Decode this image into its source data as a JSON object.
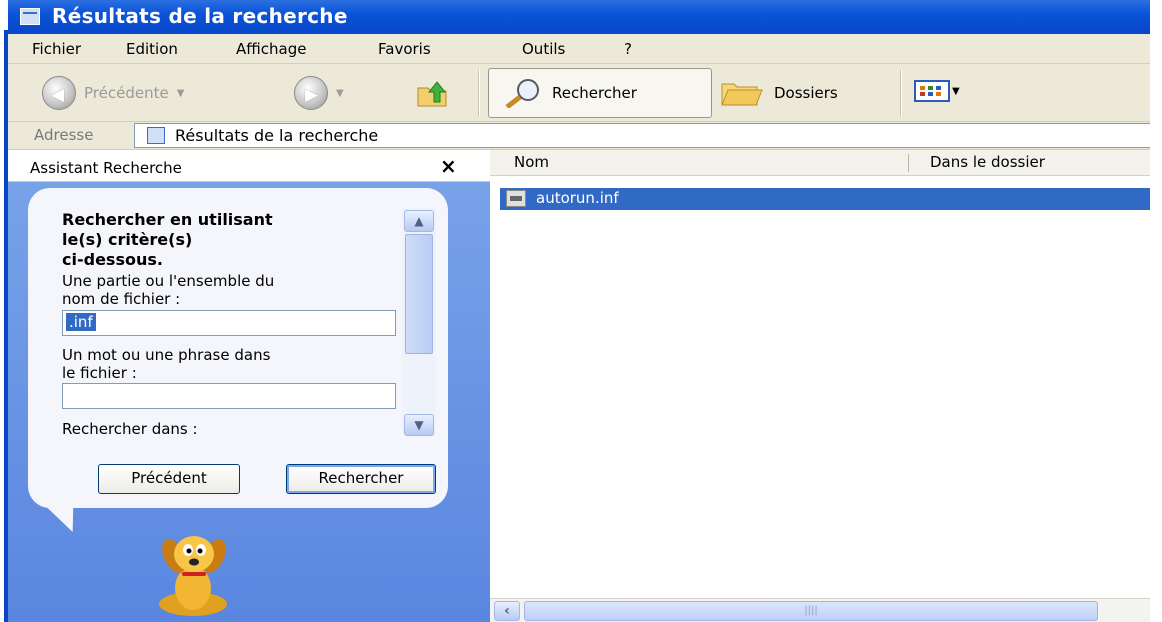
{
  "window": {
    "title": "Résultats de la recherche",
    "title_icon": "search-results-window-icon"
  },
  "menu": {
    "items": [
      "Fichier",
      "Edition",
      "Affichage",
      "Favoris",
      "Outils",
      "?"
    ]
  },
  "toolbar": {
    "back_label": "Précédente",
    "search_label": "Rechercher",
    "folders_label": "Dossiers",
    "icons": [
      "back-arrow-icon",
      "forward-arrow-icon",
      "up-folder-icon",
      "magnifier-icon",
      "folders-icon",
      "views-icon"
    ]
  },
  "address": {
    "label": "Adresse",
    "value": "Résultats de la recherche"
  },
  "search_pane": {
    "title": "Assistant Recherche",
    "close_glyph": "×",
    "heading_lines": [
      "Rechercher en utilisant",
      "le(s) critère(s)",
      "ci-dessous."
    ],
    "filename_label_lines": [
      "Une partie ou l'ensemble du",
      "nom de fichier :"
    ],
    "filename_value": ".inf",
    "phrase_label_lines": [
      "Un mot ou une phrase dans",
      "le fichier :"
    ],
    "phrase_value": "",
    "look_in_label": "Rechercher dans :",
    "back_button": "Précédent",
    "search_button": "Rechercher"
  },
  "results": {
    "columns": [
      "Nom",
      "Dans le dossier"
    ],
    "rows": [
      {
        "name": "autorun.inf",
        "folder": "",
        "selected": true
      }
    ]
  },
  "colors": {
    "titlebar": "#0a54d8",
    "selection": "#316ac5",
    "pane_background": "#6a94e6",
    "chrome": "#ece9d8"
  }
}
